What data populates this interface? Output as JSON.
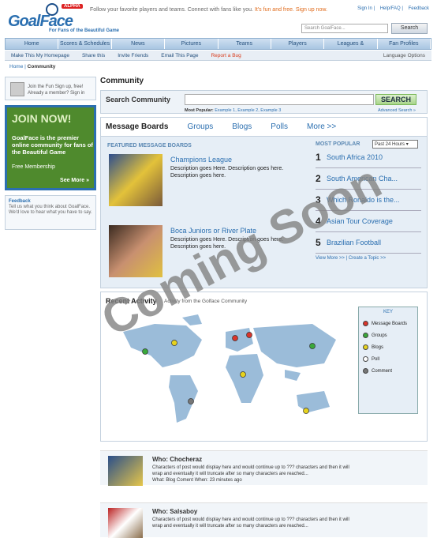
{
  "header": {
    "logo": "GoalFace",
    "beta": "ALPHA",
    "logo_tagline": "For Fans of the Beautiful Game",
    "tagline": "Follow your favorite players and teams. Connect with fans like you.",
    "tagline_hl": "It's fun and free. Sign up now.",
    "links": [
      "Sign In",
      "Help/FAQ",
      "Feedback"
    ],
    "search_placeholder": "Search GoalFace...",
    "search_btn": "Search"
  },
  "nav": [
    "Home",
    "Scores & Schedules",
    "News",
    "Pictures",
    "Teams",
    "Players",
    "Leagues & Tournaments",
    "Fan Profiles"
  ],
  "subnav": {
    "items": [
      "Make This My Homepage",
      "Share this",
      "Invite Friends",
      "Email This Page"
    ],
    "bug": "Report a Bug",
    "lang": "Language Options"
  },
  "breadcrumb": {
    "home": "Home",
    "current": "Community"
  },
  "left": {
    "join_text": "Join the Fun Sign up, free! Already a member? Sign in",
    "join_now": "JOIN NOW!",
    "join_tagline": "GoalFace is the premier online community for fans of the Beautiful Game",
    "free": "Free Membership",
    "see_more": "See More »",
    "feedback_title": "Feedback",
    "feedback_text": "Tell us what you think about GoalFace. We'd love to hear what you have to say."
  },
  "main": {
    "title": "Community",
    "search_label": "Search Community",
    "search_btn": "SEARCH",
    "popular": "Most Popular:",
    "examples": [
      "Example 1,",
      "Example 2,",
      "Example 3"
    ],
    "advanced": "Advanced Search »",
    "tabs": [
      "Message Boards",
      "Groups",
      "Blogs",
      "Polls",
      "More >>"
    ],
    "featured_header": "FEATURED MESSAGE BOARDS",
    "featured": [
      {
        "title": "Champions League",
        "desc": "Description goes Here. Description goes here. Description goes here."
      },
      {
        "title": "Boca Juniors or River Plate",
        "desc": "Description goes Here. Description goes here. Description goes here."
      }
    ],
    "most_popular": "MOST POPULAR",
    "dropdown": "Past 24 Hours",
    "popular_list": [
      "South Africa 2010",
      "South American Cha...",
      "Which Ronaldo is the...",
      "Asian Tour Coverage",
      "Brazilian Football"
    ],
    "view_more": "View More >>",
    "create_topic": "Create a Topic >>",
    "recent": "Recent Activity",
    "recent_sub": "Activity from the Golface Community",
    "key_title": "KEY",
    "key": [
      "Message Boards",
      "Groups",
      "Blogs",
      "Poll",
      "Comment"
    ],
    "posts": [
      {
        "who": "Who: Chocheraz",
        "text": "Characters of post would display here and would continue up to ??? characters and then it will wrap and eventually it will truncate after so many characters are reached...",
        "meta": "What: Blog Coment   When: 23 minutes ago"
      },
      {
        "who": "Who: Salsaboy",
        "text": "Characters of post would display here and would continue up to ??? characters and then it will wrap and eventually it will truncate after so many characters are reached...",
        "meta": ""
      }
    ],
    "watermark": "Coming Soon"
  },
  "colors": {
    "brand": "#2b6fb0",
    "join_bg": "#4f8a2d",
    "mp": "#e6eef6",
    "red": "#d9342b",
    "green": "#3aa83a",
    "yellow": "#e6d21e"
  }
}
